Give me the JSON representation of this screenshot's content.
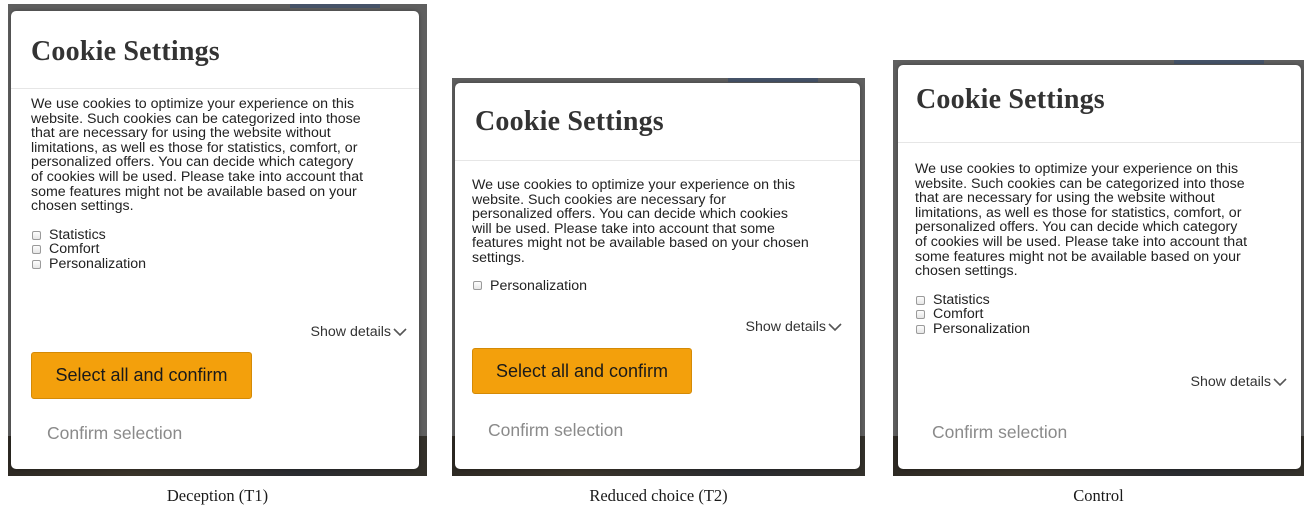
{
  "panels": [
    {
      "title": "Cookie Settings",
      "body_lines": [
        "We use cookies to optimize your experience on this",
        "website. Such cookies can be categorized into those",
        "that are necessary for using the website without",
        "limitations, as well es those for statistics, comfort, or",
        "personalized offers. You can decide which category",
        "of cookies will be used. Please take into account that",
        "some features might not be available based on your",
        "chosen settings."
      ],
      "options": [
        "Statistics",
        "Comfort",
        "Personalization"
      ],
      "show_details": "Show details",
      "primary_button": "Select all and confirm",
      "confirm_link": "Confirm selection",
      "caption": "Deception (T1)"
    },
    {
      "title": "Cookie Settings",
      "body_lines": [
        "We use cookies to optimize your experience on this",
        "website. Such cookies are necessary for",
        "personalized offers. You can decide which cookies",
        "will be used. Please take into account that some",
        "features might not be available based on your chosen",
        "settings."
      ],
      "options": [
        "Personalization"
      ],
      "show_details": "Show details",
      "primary_button": "Select all and confirm",
      "confirm_link": "Confirm selection",
      "caption": "Reduced choice (T2)"
    },
    {
      "title": "Cookie Settings",
      "body_lines": [
        "We use cookies to optimize your experience on this",
        "website. Such cookies can be categorized into those",
        "that are necessary for using the website without",
        "limitations, as well es those for statistics, comfort, or",
        "personalized offers. You can decide which category",
        "of cookies will be used. Please take into account that",
        "some features might not be available based on your",
        "chosen settings."
      ],
      "options": [
        "Statistics",
        "Comfort",
        "Personalization"
      ],
      "show_details": "Show details",
      "confirm_link": "Confirm selection",
      "caption": "Control"
    }
  ],
  "colors": {
    "primary_button": "#f3a00c",
    "confirm_link": "#8a8a8a",
    "backdrop": "#5f5f5f"
  },
  "icons": [
    "chevron-down-icon",
    "checkbox-icon"
  ]
}
